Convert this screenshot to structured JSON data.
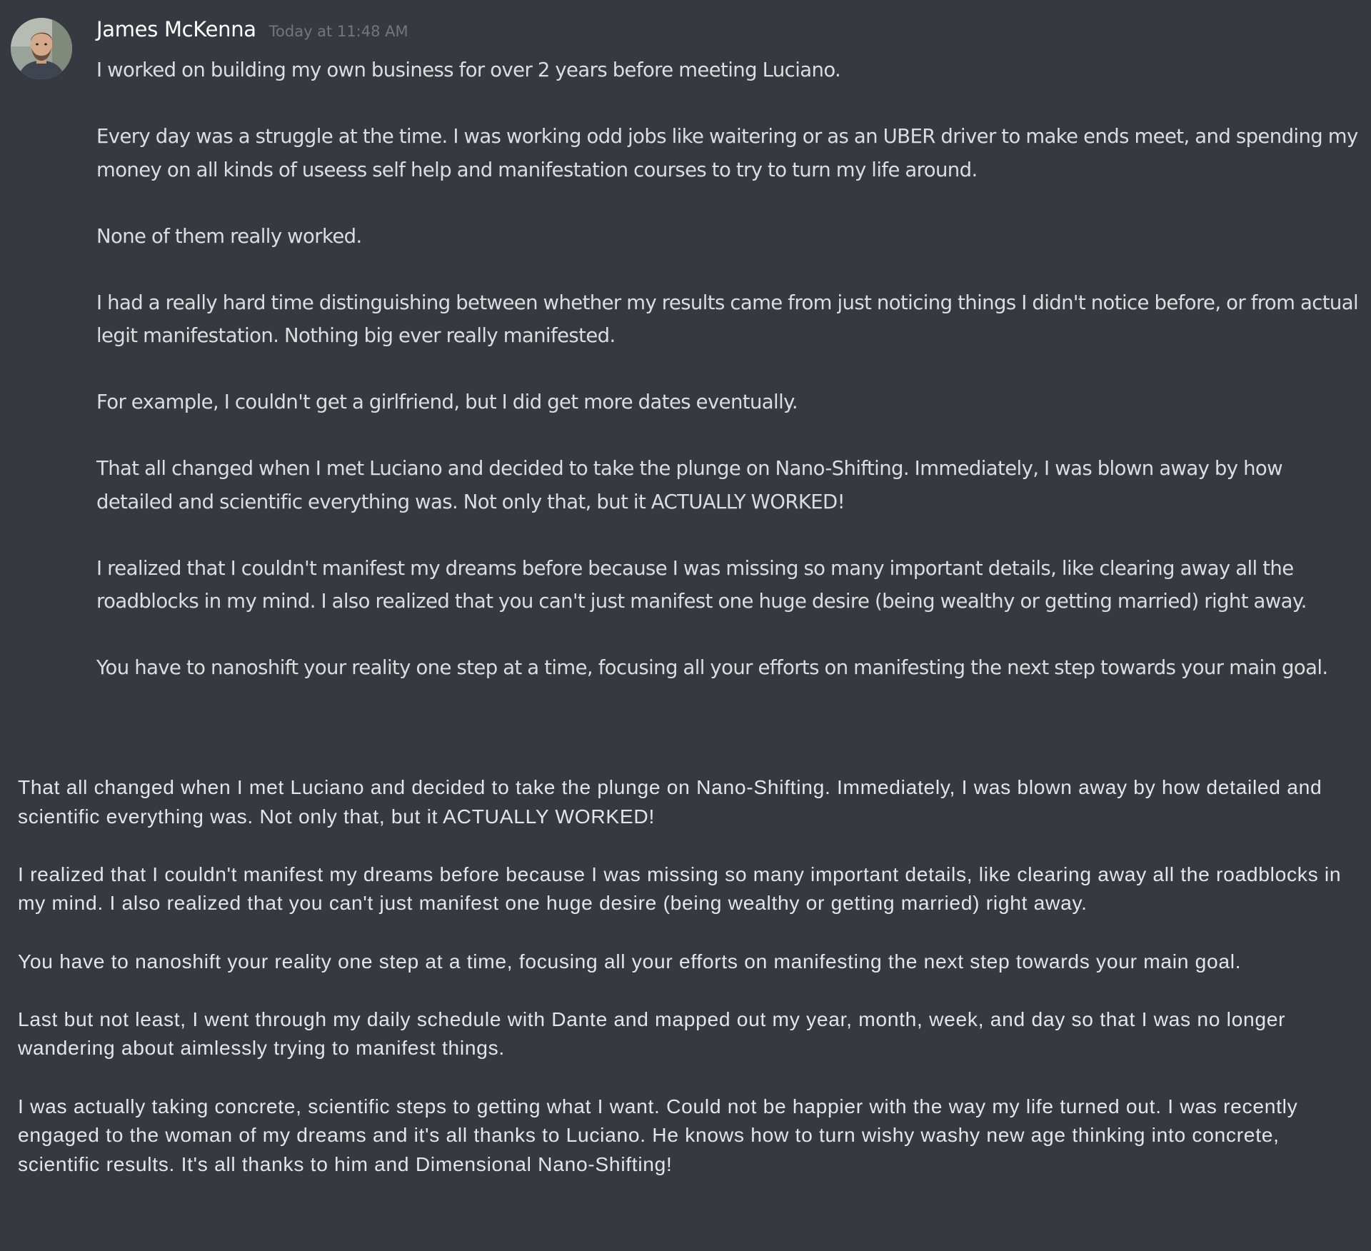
{
  "message": {
    "author": "James McKenna",
    "timestamp": "Today at 11:48 AM",
    "avatar_icon": "user-avatar",
    "paragraphs": [
      "I worked on building my own business for over 2 years before meeting Luciano.",
      "Every day was a struggle at the time. I was working odd jobs like waitering or as an UBER driver to make ends meet, and spending my money on all kinds of useess self help and manifestation courses to try to turn my life around.",
      "None of them really worked.",
      "I had a really hard time distinguishing between whether my results came from just noticing things I didn't notice before, or from actual legit manifestation. Nothing big ever really manifested.",
      "For example, I couldn't get a girlfriend, but I did get more dates eventually.",
      "That all changed when I met Luciano and decided to take the plunge on Nano-Shifting. Immediately, I was blown away by how detailed and scientific everything was. Not only that, but it ACTUALLY WORKED!",
      "I realized that I couldn't manifest my dreams before because I was missing so many important details, like clearing away all the roadblocks in my mind. I also realized that you can't just manifest one huge desire (being wealthy or getting married) right away.",
      "You have to nanoshift your reality one step at a time, focusing all your efforts on manifesting the next step towards your main goal."
    ]
  },
  "continuation": {
    "paragraphs": [
      "That all changed when I met Luciano and decided to take the plunge on Nano-Shifting. Immediately, I was blown away by how detailed and scientific everything was. Not only that, but it ACTUALLY WORKED!",
      "I realized that I couldn't manifest my dreams before because I was missing so many important details, like clearing away all the roadblocks in my mind. I also realized that you can't just manifest one huge desire (being wealthy or getting married) right away.",
      "You have to nanoshift your reality one step at a time, focusing all your efforts on manifesting the next step towards your main goal.",
      "Last but not least, I went through my daily schedule with Dante and mapped out my year, month, week, and day so that I was no longer wandering about aimlessly trying to manifest things.",
      "I was actually taking concrete, scientific steps to getting what I want. Could not be happier with the way my life turned out. I was recently engaged to the woman of my dreams and it's all thanks to Luciano. He knows how to turn wishy washy new age thinking into concrete, scientific results. It's all thanks to him and Dimensional Nano-Shifting!"
    ]
  },
  "colors": {
    "background": "#36393f",
    "username": "#ffffff",
    "timestamp": "#72767d",
    "text": "#dcddde"
  }
}
